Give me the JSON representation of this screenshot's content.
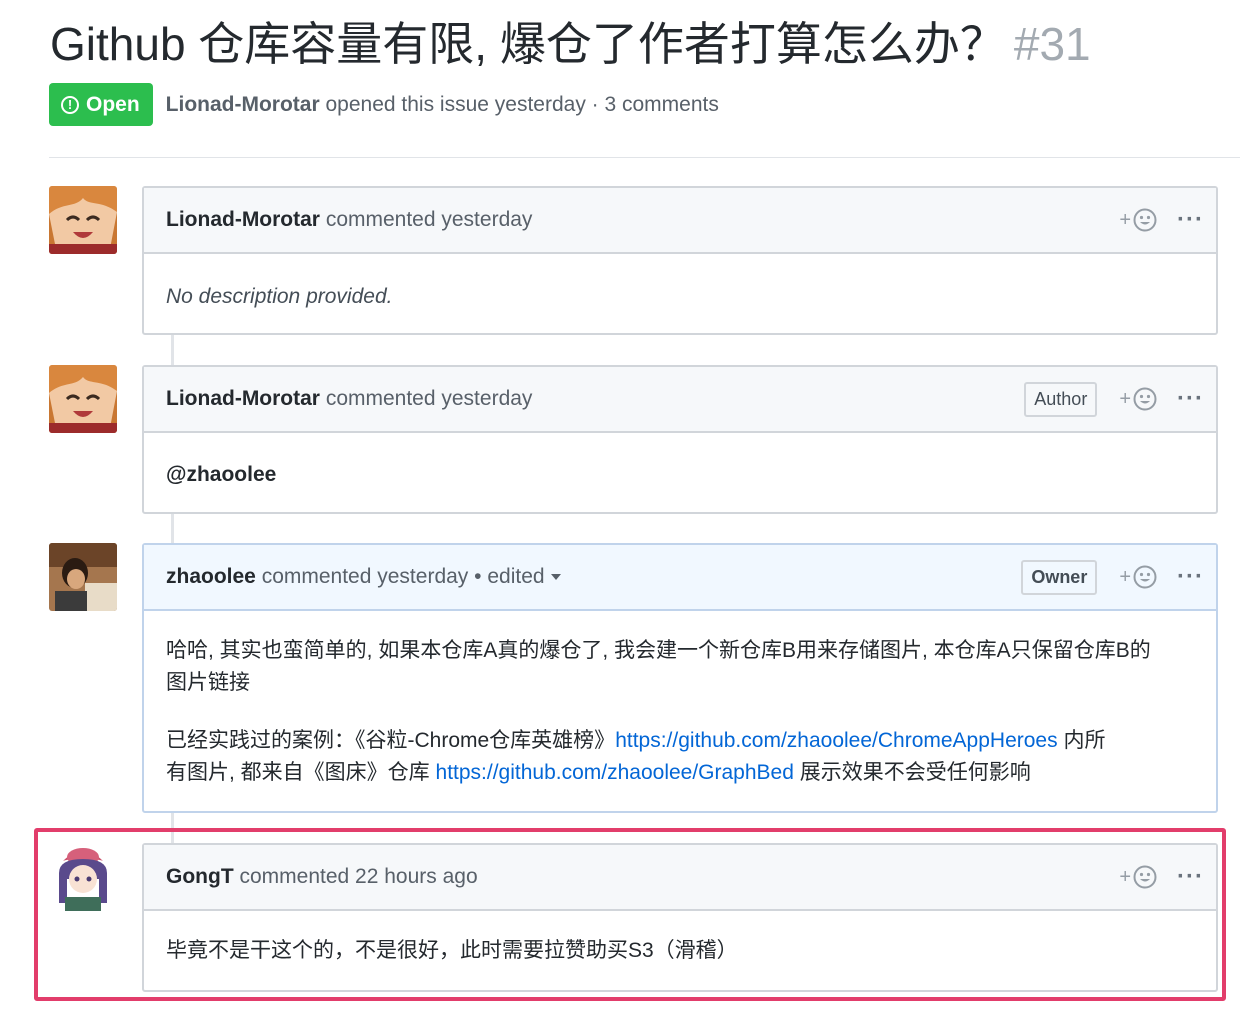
{
  "issue": {
    "title": "Github 仓库容量有限, 爆仓了作者打算怎么办？",
    "number": "#31",
    "state_label": "Open",
    "state_icon": "issue-opened-icon",
    "author": "Lionad-Morotar",
    "meta_suffix": "opened this issue yesterday · 3 comments",
    "colors": {
      "open": "#2cbe4e",
      "link": "#0366d6",
      "highlight": "#e23d6b"
    }
  },
  "comments": [
    {
      "author": "Lionad-Morotar",
      "action": "commented yesterday",
      "role": "",
      "body": [
        "No description provided."
      ]
    },
    {
      "author": "Lionad-Morotar",
      "action": "commented yesterday",
      "role": "Author",
      "body": [
        "@zhaoolee"
      ]
    },
    {
      "author": "zhaoolee",
      "action": "commented yesterday",
      "edited": "• edited",
      "role": "Owner",
      "para1_line1": "哈哈, 其实也蛮简单的, 如果本仓库A真的爆仓了, 我会建一个新仓库B用来存储图片, 本仓库A只保留仓库B的",
      "para1_line2": "图片链接",
      "para2_a": "已经实践过的案例：《谷粒-Chrome仓库英雄榜》",
      "link1": "https://github.com/zhaoolee/ChromeAppHeroes",
      "para2_b": " 内所",
      "para2_c": "有图片, 都来自《图床》仓库 ",
      "link2": "https://github.com/zhaoolee/GraphBed",
      "para2_d": " 展示效果不会受任何影响"
    },
    {
      "author": "GongT",
      "action": "commented 22 hours ago",
      "role": "",
      "body": [
        "毕竟不是干这个的，不是很好，此时需要拉赞助买S3（滑稽）"
      ]
    }
  ],
  "reaction": {
    "plus": "+",
    "icon": "smiley-icon"
  },
  "menu_icon": "kebab-horizontal-icon"
}
